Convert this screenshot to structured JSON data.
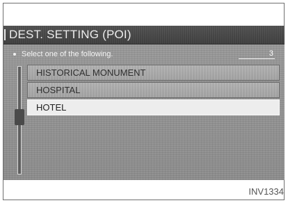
{
  "header": {
    "title": "DEST. SETTING (POI)"
  },
  "prompt": {
    "text": "Select one of the following.",
    "count": "3"
  },
  "list": {
    "items": [
      {
        "label": "HISTORICAL MONUMENT",
        "selected": false
      },
      {
        "label": "HOSPITAL",
        "selected": false
      },
      {
        "label": "HOTEL",
        "selected": true
      }
    ]
  },
  "caption": {
    "code": "INV1334"
  },
  "colors": {
    "screen_bg": "#8d8d8d",
    "title_bar": "#414141",
    "list_item": "#a5a5a5",
    "list_item_selected": "#ededed",
    "text_light": "#f4f4f4",
    "text_dark": "#2f2f2f"
  },
  "icons": {
    "bullet": "bullet-dot",
    "scroll": "vertical-scrollbar"
  }
}
